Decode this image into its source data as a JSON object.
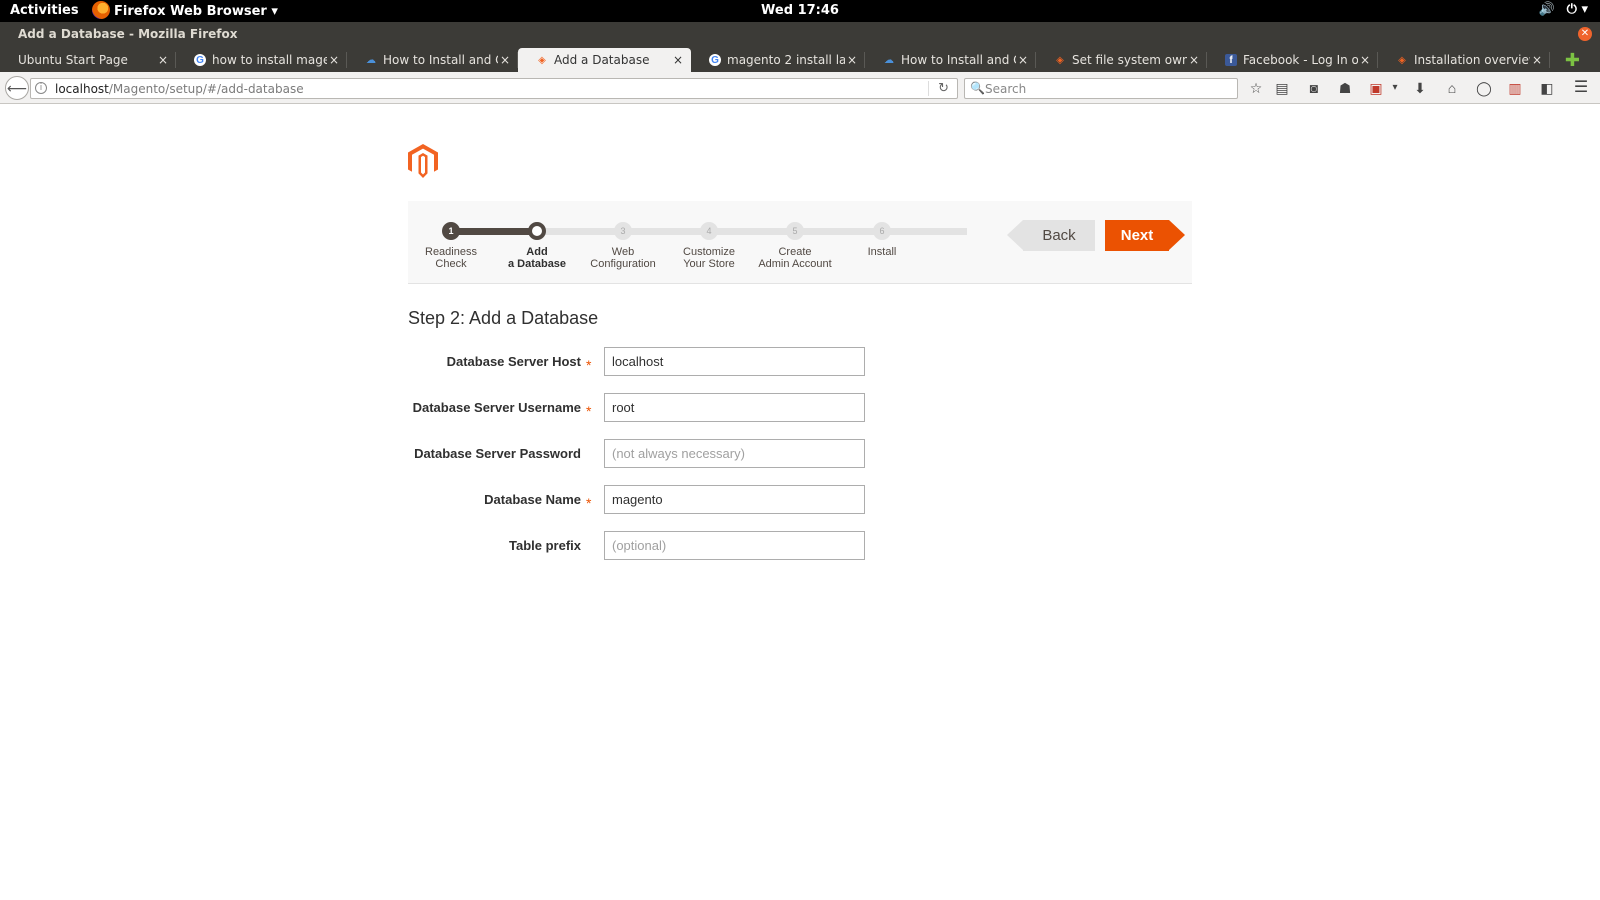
{
  "desktop": {
    "activities": "Activities",
    "app_menu": "Firefox Web Browser ▾",
    "clock": "Wed 17:46",
    "sound_icon": "🔊",
    "power_icon": "⏻ ▾"
  },
  "window": {
    "title": "Add a Database - Mozilla Firefox",
    "close_glyph": "✕"
  },
  "tabs": [
    {
      "label": "Ubuntu Start Page",
      "icon": "none"
    },
    {
      "label": "how to install mage…",
      "icon": "google"
    },
    {
      "label": "How to Install and C…",
      "icon": "cloud"
    },
    {
      "label": "Add a Database",
      "icon": "magento",
      "active": true
    },
    {
      "label": "magento 2 install la…",
      "icon": "google"
    },
    {
      "label": "How to Install and C…",
      "icon": "cloud"
    },
    {
      "label": "Set file system own…",
      "icon": "magento"
    },
    {
      "label": "Facebook - Log In o…",
      "icon": "facebook"
    },
    {
      "label": "Installation overview",
      "icon": "magento"
    }
  ],
  "tab_close": "×",
  "new_tab": "✚",
  "navbar": {
    "back": "⟵",
    "url_host": "localhost",
    "url_path": "/Magento/setup/#/add-database",
    "reload": "↻",
    "search_placeholder": "Search",
    "search_icon": "🔍",
    "toolbar_icons": [
      "☆",
      "▤",
      "◙",
      "☗",
      "▣",
      "▾",
      "⬇",
      "⌂",
      "◯",
      "▥",
      "◧",
      "☰"
    ]
  },
  "wizard": {
    "steps": [
      {
        "num": "1",
        "label_line1": "Readiness",
        "label_line2": "Check",
        "state": "done"
      },
      {
        "num": "",
        "label_line1": "Add",
        "label_line2": "a Database",
        "state": "current"
      },
      {
        "num": "3",
        "label_line1": "Web",
        "label_line2": "Configuration",
        "state": "todo"
      },
      {
        "num": "4",
        "label_line1": "Customize",
        "label_line2": "Your Store",
        "state": "todo"
      },
      {
        "num": "5",
        "label_line1": "Create",
        "label_line2": "Admin Account",
        "state": "todo"
      },
      {
        "num": "6",
        "label_line1": "Install",
        "label_line2": "",
        "state": "todo"
      }
    ],
    "back_label": "Back",
    "next_label": "Next",
    "accent_color": "#eb5202",
    "step_title": "Step 2: Add a Database"
  },
  "form": {
    "host_label": "Database Server Host",
    "host_value": "localhost",
    "user_label": "Database Server Username",
    "user_value": "root",
    "pass_label": "Database Server Password",
    "pass_placeholder": "(not always necessary)",
    "dbname_label": "Database Name",
    "dbname_value": "magento",
    "prefix_label": "Table prefix",
    "prefix_placeholder": "(optional)",
    "required_mark": "*"
  }
}
